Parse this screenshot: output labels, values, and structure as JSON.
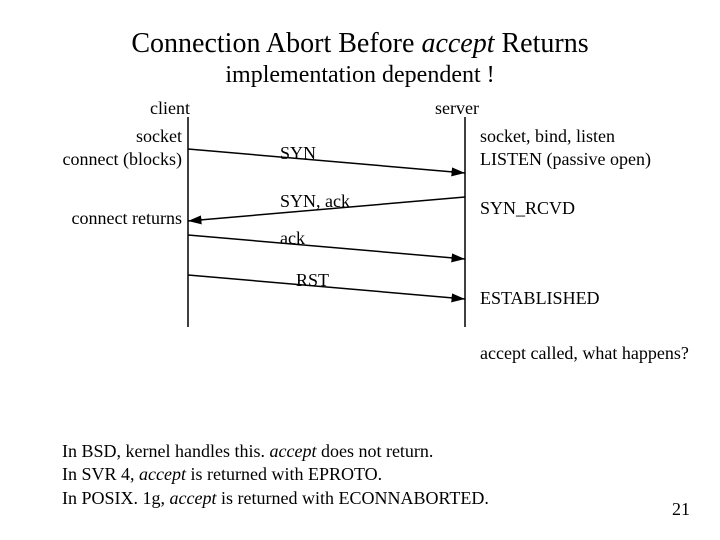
{
  "title_pre": "Connection Abort Before ",
  "title_it": "accept",
  "title_post": " Returns",
  "subtitle": "implementation dependent !",
  "client_label": "client",
  "server_label": "server",
  "left1": "socket\nconnect (blocks)",
  "left2": "connect returns",
  "right1": "socket, bind, listen\nLISTEN (passive open)",
  "right2": "SYN_RCVD",
  "right3": "ESTABLISHED",
  "right4": "accept called, what happens?",
  "msg_syn": "SYN",
  "msg_synack": "SYN, ack",
  "msg_ack": "ack",
  "msg_rst": "RST",
  "foot1a": "In BSD, kernel handles this. ",
  "foot1b": "accept",
  "foot1c": " does not return.",
  "foot2a": "In SVR 4, ",
  "foot2b": "accept",
  "foot2c": " is returned with EPROTO.",
  "foot3a": "In POSIX. 1g, ",
  "foot3b": "accept",
  "foot3c": " is returned with ECONNABORTED.",
  "pagenum": "21"
}
